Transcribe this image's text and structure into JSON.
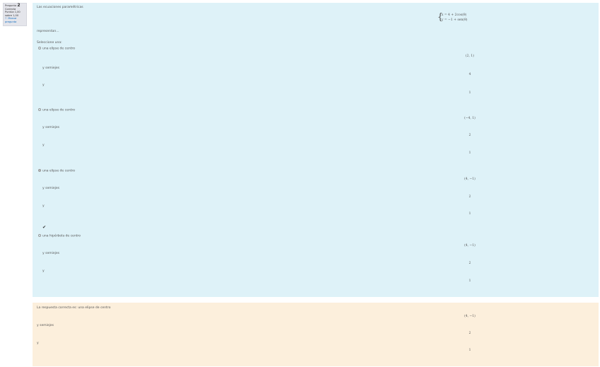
{
  "info": {
    "question_label": "Pregunta",
    "question_number": "2",
    "status": "Correcta",
    "score_line1": "Puntúa 1,00",
    "score_line2": "sobre 1,00",
    "flag_label": "Marcar pregunta"
  },
  "question": {
    "prompt": "Las ecuaciones paramétricas",
    "system": {
      "line1": "x  =  4 + 2cos(θ)",
      "line2": "y  =  −1 + sen(θ)"
    },
    "represent": "representan...",
    "select_one": "Seleccione una:",
    "options": [
      {
        "label": "una elipse de centro",
        "center": "(2, 1)",
        "semi_label": "y semiejes",
        "a": "4",
        "y_label": "y",
        "b": "1",
        "selected": false
      },
      {
        "label": "una elipse de centro",
        "center": "(−4, 1)",
        "semi_label": "y semiejes",
        "a": "2",
        "y_label": "y",
        "b": "1",
        "selected": false
      },
      {
        "label": "una elipse de centro",
        "center": "(4, −1)",
        "semi_label": "y semiejes",
        "a": "2",
        "y_label": "y",
        "b": "1",
        "selected": true
      },
      {
        "label": "una hipérbola de centro",
        "center": "(4, −1)",
        "semi_label": "y semiejes",
        "a": "2",
        "y_label": "y",
        "b": "1",
        "selected": false
      }
    ]
  },
  "feedback": {
    "text": "La respuesta correcta es: una elipse de centro",
    "center": "(4, −1)",
    "semi_label": "y semiejes",
    "a": "2",
    "y_label": "y",
    "b": "1"
  }
}
